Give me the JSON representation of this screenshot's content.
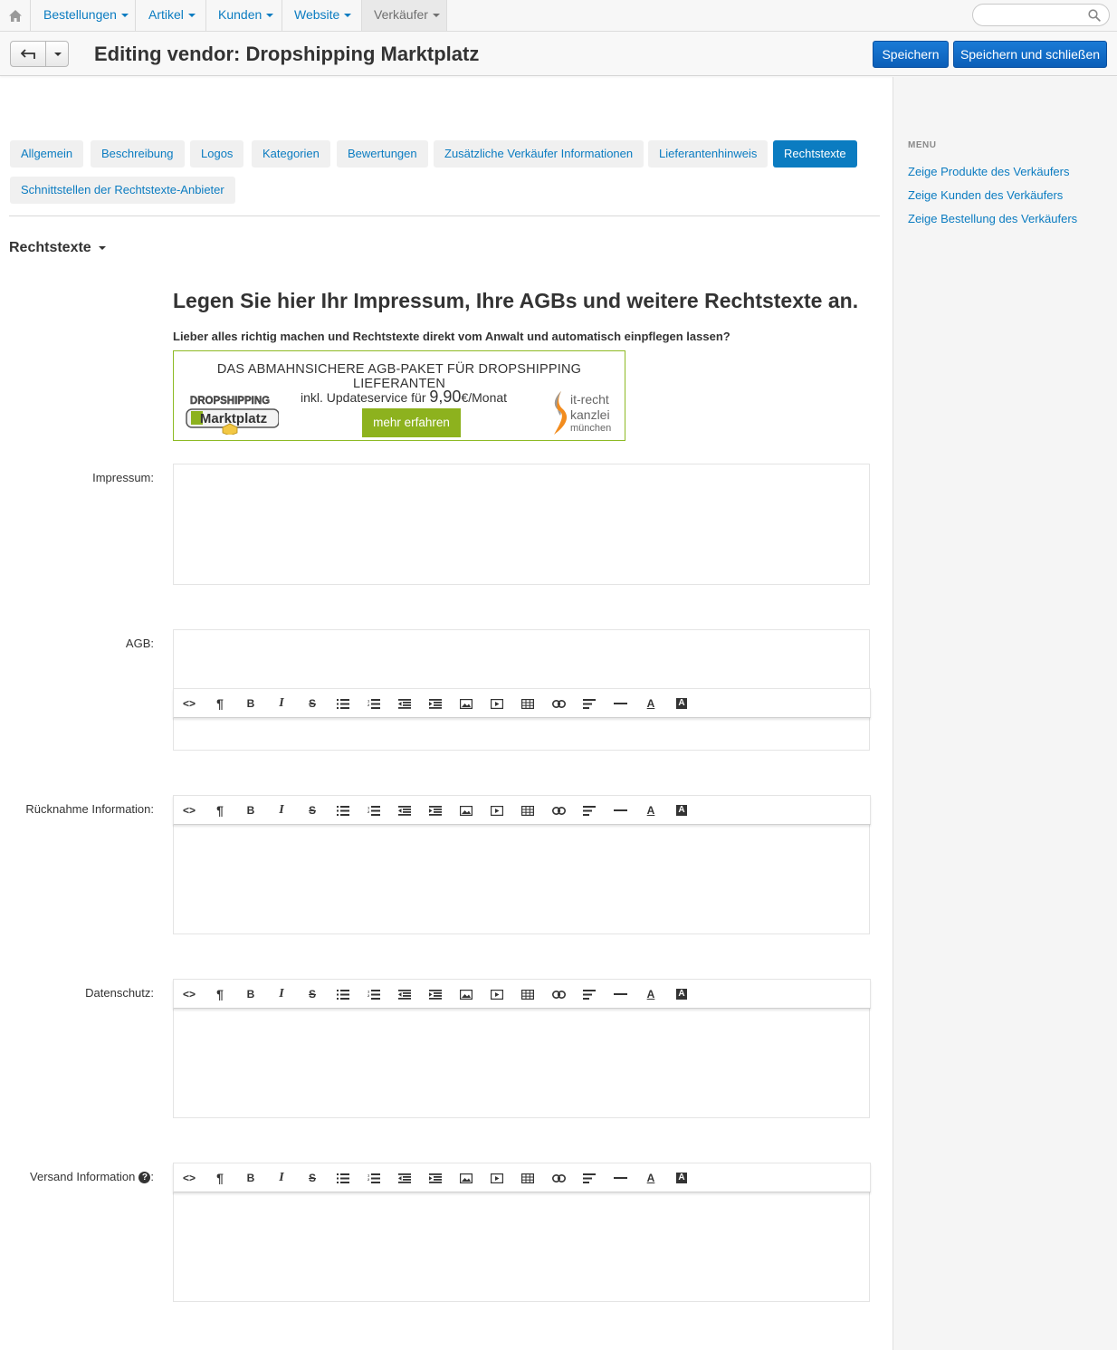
{
  "topnav": {
    "home_icon": "home-icon",
    "items": [
      {
        "label": "Bestellungen"
      },
      {
        "label": "Artikel"
      },
      {
        "label": "Kunden"
      },
      {
        "label": "Website"
      },
      {
        "label": "Verkäufer"
      }
    ],
    "search": {
      "value": "",
      "placeholder": "",
      "icon": "search-icon"
    }
  },
  "header": {
    "title": "Editing vendor: Dropshipping Marktplatz",
    "save_label": "Speichern",
    "save_close_label": "Speichern und schließen",
    "accent_color": "#0b5fb8"
  },
  "tabs": [
    {
      "label": "Allgemein"
    },
    {
      "label": "Beschreibung"
    },
    {
      "label": "Logos"
    },
    {
      "label": "Kategorien"
    },
    {
      "label": "Bewertungen"
    },
    {
      "label": "Zusätzliche Verkäufer Informationen"
    },
    {
      "label": "Lieferantenhinweis"
    },
    {
      "label": "Rechtstexte",
      "active": true
    },
    {
      "label": "Schnittstellen der Rechtstexte-Anbieter"
    }
  ],
  "section": {
    "title": "Rechtstexte"
  },
  "promo": {
    "heading": "Legen Sie hier Ihr Impressum, Ihre AGBs und weitere Rechtstexte an.",
    "subheading": "Lieber alles richtig machen und Rechtstexte direkt vom Anwalt und automatisch einpflegen lassen?",
    "banner": {
      "title": "DAS ABMAHNSICHERE AGB-PAKET FÜR DROPSHIPPING LIEFERANTEN",
      "price_prefix": "inkl. Updateservice für",
      "price": "9,90",
      "price_suffix": "€/Monat",
      "button": "mehr erfahren",
      "logo_line1": "DROPSHIPPING",
      "logo_line2": "Marktplatz",
      "kanzlei_line1": "it-recht",
      "kanzlei_line2": "kanzlei",
      "kanzlei_line3": "münchen",
      "border_color": "#8dba24"
    }
  },
  "fields": {
    "impressum": {
      "label": "Impressum:",
      "value": ""
    },
    "agb": {
      "label": "AGB:",
      "value": ""
    },
    "ruecknahme": {
      "label": "Rücknahme Information:",
      "value": ""
    },
    "datenschutz": {
      "label": "Datenschutz:",
      "value": ""
    },
    "versand": {
      "label": "Versand Information",
      "value": ""
    }
  },
  "toolbar_buttons": [
    {
      "name": "html-icon",
      "glyph": "<>"
    },
    {
      "name": "paragraph-icon",
      "glyph": "¶"
    },
    {
      "name": "bold-icon",
      "glyph": "B"
    },
    {
      "name": "italic-icon",
      "glyph": "I"
    },
    {
      "name": "strikethrough-icon",
      "glyph": "S"
    },
    {
      "name": "bullet-list-icon",
      "glyph": ""
    },
    {
      "name": "numbered-list-icon",
      "glyph": ""
    },
    {
      "name": "outdent-icon",
      "glyph": ""
    },
    {
      "name": "indent-icon",
      "glyph": ""
    },
    {
      "name": "image-icon",
      "glyph": ""
    },
    {
      "name": "video-icon",
      "glyph": ""
    },
    {
      "name": "table-icon",
      "glyph": ""
    },
    {
      "name": "link-icon",
      "glyph": ""
    },
    {
      "name": "align-icon",
      "glyph": ""
    },
    {
      "name": "horizontal-rule-icon",
      "glyph": ""
    },
    {
      "name": "font-color-icon",
      "glyph": "A"
    },
    {
      "name": "background-color-icon",
      "glyph": "A"
    }
  ],
  "sidebar": {
    "menu_title": "MENU",
    "links": [
      {
        "label": "Zeige Produkte des Verkäufers"
      },
      {
        "label": "Zeige Kunden des Verkäufers"
      },
      {
        "label": "Zeige Bestellung des Verkäufers"
      }
    ]
  }
}
